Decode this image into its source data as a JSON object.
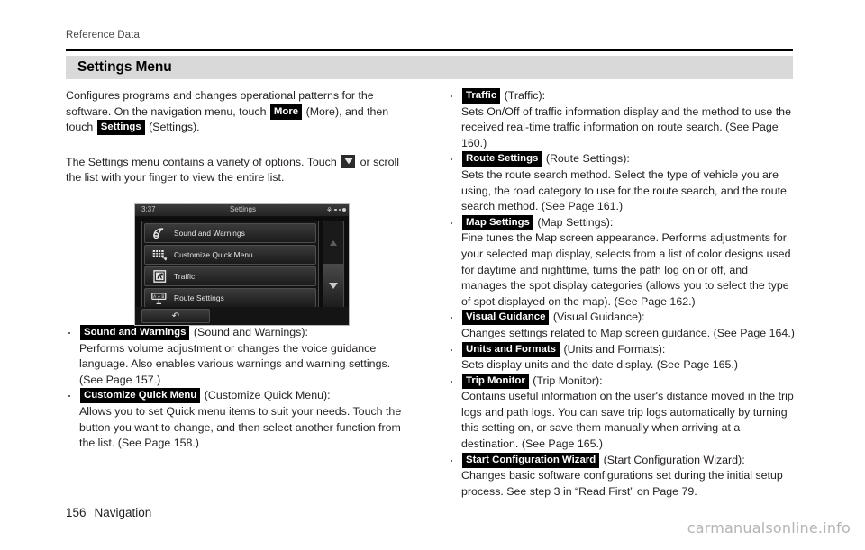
{
  "running_head": "Reference Data",
  "section": {
    "title": "Settings Menu"
  },
  "intro": {
    "p1_a": "Configures programs and changes operational patterns for the software. On the navigation menu, touch ",
    "key_more": "More",
    "p1_b": " (More), and then touch ",
    "key_settings": "Settings",
    "p1_c": " (Settings).",
    "p2_a": "The Settings menu contains a variety of options. Touch ",
    "p2_b": " or scroll the list with your finger to view the entire list."
  },
  "nav_screen": {
    "clock": "3:37",
    "title": "Settings",
    "items": [
      {
        "label": "Sound and Warnings",
        "icon": "speaker-icon"
      },
      {
        "label": "Customize Quick Menu",
        "icon": "grid-keypad-icon"
      },
      {
        "label": "Traffic",
        "icon": "traffic-sign-icon"
      },
      {
        "label": "Route Settings",
        "icon": "route-sign-icon"
      }
    ],
    "back_glyph": "↶",
    "scroll_up_icon": "triangle-up-icon",
    "scroll_down_icon": "triangle-down-icon"
  },
  "left_bullets": [
    {
      "key": "Sound and Warnings",
      "paren": " (Sound and Warnings):",
      "body": "Performs volume adjustment or changes the voice guidance language. Also enables various warnings and warning settings. (See Page 157.)"
    },
    {
      "key": "Customize Quick Menu",
      "paren": " (Customize Quick Menu):",
      "body": "Allows you to set Quick menu items to suit your needs. Touch the button you want to change, and then select another function from the list. (See Page 158.)"
    }
  ],
  "right_bullets": [
    {
      "key": "Traffic",
      "paren": " (Traffic):",
      "body": "Sets On/Off of traffic information display and the method to use the received real-time traffic information on route search. (See Page 160.)"
    },
    {
      "key": "Route Settings",
      "paren": " (Route Settings):",
      "body": "Sets the route search method. Select the type of vehicle you are using, the road category to use for the route search, and the route search method. (See Page 161.)"
    },
    {
      "key": "Map Settings",
      "paren": " (Map Settings):",
      "body": "Fine tunes the Map screen appearance. Performs adjustments for your selected map display, selects from a list of color designs used for daytime and nighttime, turns the path log on or off, and manages the spot display categories (allows you to select the type of spot displayed on the map). (See Page 162.)"
    },
    {
      "key": "Visual Guidance",
      "paren": " (Visual Guidance):",
      "body": "Changes settings related to Map screen guidance. (See Page 164.)"
    },
    {
      "key": "Units and Formats",
      "paren": " (Units and Formats):",
      "body": "Sets display units and the date display. (See Page 165.)"
    },
    {
      "key": "Trip Monitor",
      "paren": " (Trip Monitor):",
      "body": "Contains useful information on the user's distance moved in the trip logs and path logs. You can save trip logs automatically by turning this setting on, or save them manually when arriving at a destination. (See Page 165.)"
    },
    {
      "key": "Start Configuration Wizard",
      "paren": " (Start Configuration Wizard):",
      "body": "Changes basic software configurations set during the initial setup process. See step 3 in “Read First” on Page 79."
    }
  ],
  "footer": {
    "page_number": "156",
    "chapter": "Navigation",
    "watermark": "carmanualsonline.info"
  },
  "colors": {
    "section_bar": "#d9d9d9",
    "rule": "#000000",
    "key_chip_bg": "#000000",
    "text": "#231f20",
    "watermark": "#b4b4b4"
  }
}
